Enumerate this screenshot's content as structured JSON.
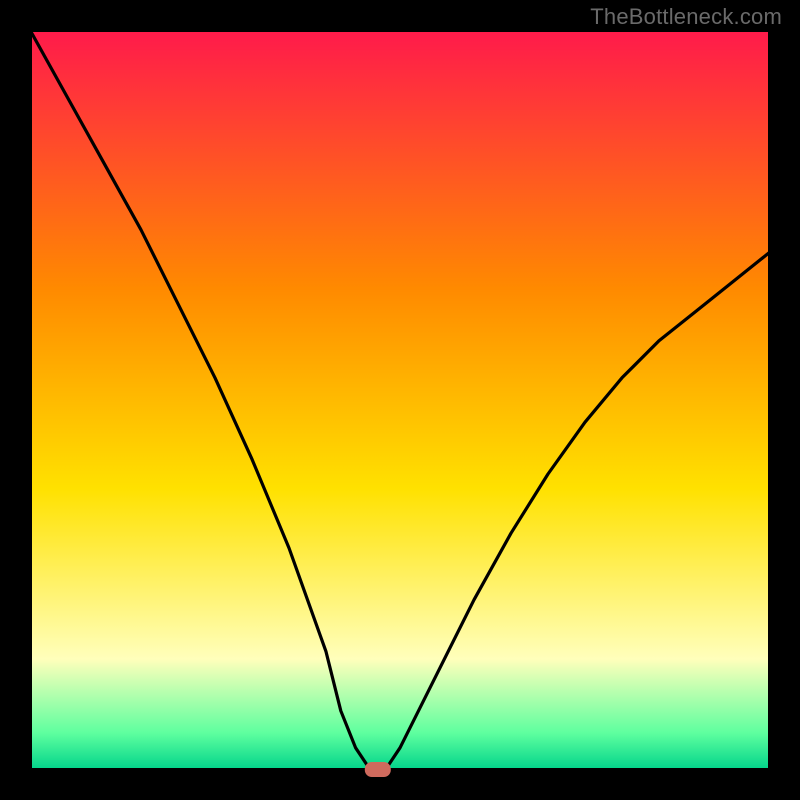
{
  "watermark": "TheBottleneck.com",
  "colors": {
    "frame": "#000000",
    "curve": "#000000",
    "marker": "#cf6a5d",
    "grad_top": "#ff1a4b",
    "grad_mid1": "#ff8a00",
    "grad_mid2": "#ffe100",
    "grad_mid3": "#ffffbb",
    "grad_bot1": "#5eff9f",
    "grad_bot2": "#00d38a"
  },
  "chart_data": {
    "type": "line",
    "title": "",
    "xlabel": "",
    "ylabel": "",
    "xlim": [
      0,
      100
    ],
    "ylim": [
      0,
      100
    ],
    "series": [
      {
        "name": "bottleneck-curve",
        "x": [
          0,
          5,
          10,
          15,
          20,
          25,
          30,
          35,
          40,
          42,
          44,
          46,
          47,
          48,
          50,
          55,
          60,
          65,
          70,
          75,
          80,
          85,
          90,
          95,
          100
        ],
        "values": [
          100,
          91,
          82,
          73,
          63,
          53,
          42,
          30,
          16,
          8,
          3,
          0,
          0,
          0,
          3,
          13,
          23,
          32,
          40,
          47,
          53,
          58,
          62,
          66,
          70
        ]
      }
    ],
    "marker": {
      "x": 47,
      "y": 0
    },
    "background_gradient": {
      "stops": [
        {
          "offset": 0.0,
          "color": "#ff1a4b"
        },
        {
          "offset": 0.35,
          "color": "#ff8a00"
        },
        {
          "offset": 0.62,
          "color": "#ffe100"
        },
        {
          "offset": 0.85,
          "color": "#ffffbb"
        },
        {
          "offset": 0.95,
          "color": "#5eff9f"
        },
        {
          "offset": 1.0,
          "color": "#00d38a"
        }
      ],
      "direction": "top-to-bottom"
    }
  }
}
